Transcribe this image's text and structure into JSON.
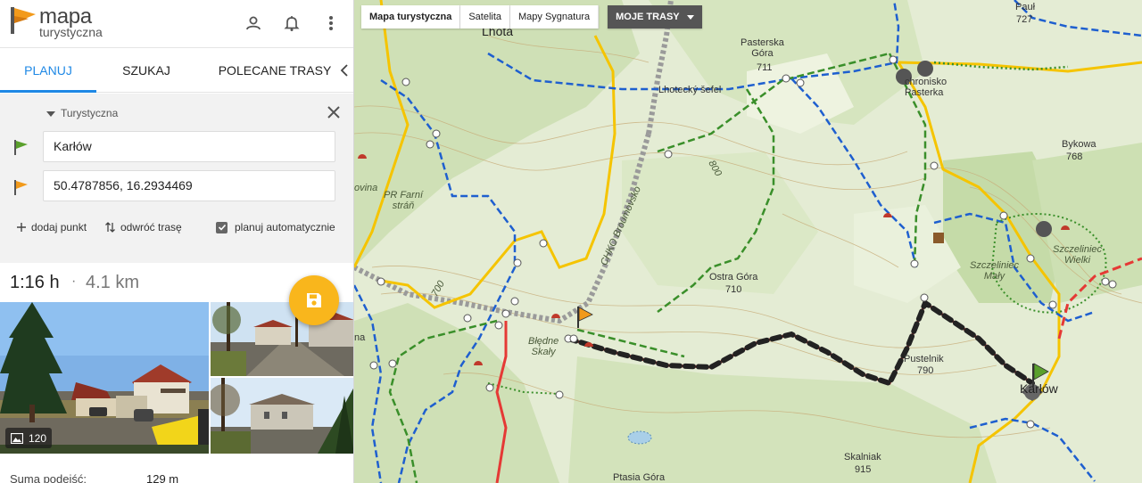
{
  "logo": {
    "line1": "mapa",
    "line2": "turystyczna"
  },
  "header_icons": [
    "user-icon",
    "bell-icon",
    "more-vert-icon"
  ],
  "tabs": [
    {
      "label": "PLANUJ",
      "active": true
    },
    {
      "label": "SZUKAJ",
      "active": false
    },
    {
      "label": "POLECANE TRASY",
      "active": false
    }
  ],
  "planner": {
    "route_type": "Turystyczna",
    "start": "Karłów",
    "end": "50.4787856, 16.2934469",
    "add_point": "dodaj punkt",
    "reverse": "odwróć trasę",
    "auto_plan": "planuj automatycznie",
    "auto_plan_checked": true
  },
  "summary": {
    "time": "1:16 h",
    "separator": "·",
    "distance": "4.1 km"
  },
  "photos": {
    "count": "120"
  },
  "stats": {
    "ascent_label": "Suma podejść:",
    "ascent_value": "129 m"
  },
  "map_toolbar": {
    "tourist": "Mapa turystyczna",
    "satellite": "Satelita",
    "signature": "Mapy Sygnatura",
    "my_routes": "MOJE TRASY"
  },
  "map_labels": {
    "lhota": "Lhota",
    "pasterska_gora": "Pasterska\nGóra",
    "pasterska_gora_elev": "711",
    "lhotecky_sefel": "Lhotecký šefel",
    "schronisko": "chronisko\nPasterka",
    "paul": "Pauł",
    "paul_elev": "727",
    "bykowa": "Bykowa",
    "bykowa_elev": "768",
    "pr_farni_stran": "PR Farní\nstráň",
    "ovina": "ovina",
    "chko": "CHKO Broumovsko",
    "ostra_gora": "Ostra Góra",
    "ostra_gora_elev": "710",
    "szczeliniec_maly": "Szczeliniec\nMały",
    "szczeliniec_wielki": "Szczeliniec\nWielki",
    "bledne_skaly": "Błędne\nSkały",
    "pustelnik": "Pustelnik",
    "pustelnik_elev": "790",
    "karlow": "Karłów",
    "skalniak": "Skalniak",
    "skalniak_elev": "915",
    "ptasia_gora": "Ptasia Góra",
    "na": "na",
    "contour_700": "700",
    "contour_800": "800"
  },
  "colors": {
    "accent": "#1e88e5",
    "fab": "#f9b61c",
    "route": "#222222",
    "trail_red": "#e53935",
    "trail_blue": "#1e5fcf",
    "trail_green": "#3a8f2a",
    "trail_yellow": "#f5c400"
  }
}
